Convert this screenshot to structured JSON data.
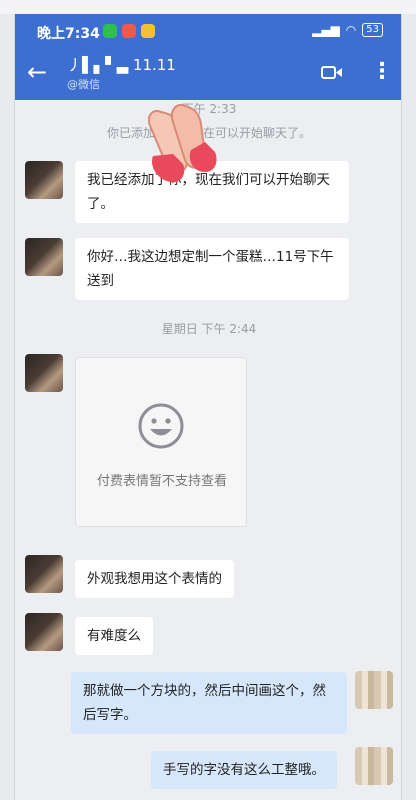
{
  "status_bar": {
    "time": "晚上7:34",
    "battery": "53"
  },
  "header": {
    "title": "丿▌▖▘▃ 11.11",
    "subtitle": "@微信",
    "back_icon": "back-arrow-icon",
    "video_icon": "video-call-icon",
    "more_icon": "more-vertical-icon"
  },
  "messages": {
    "ts1": "下午 2:33",
    "system": "你已添加了…，现在可以开始聊天了。",
    "m1": "我已经添加了你，现在我们可以开始聊天了。",
    "m2": "你好…我这边想定制一个蛋糕…11号下午送到",
    "ts2": "星期日 下午 2:44",
    "sticker_caption": "付费表情暂不支持查看",
    "m3": "外观我想用这个表情的",
    "m4": "有难度么",
    "m5": "那就做一个方块的，然后中间画这个，然后写字。",
    "m6": "手写的字没有这么工整哦。"
  },
  "colors": {
    "header": "#3d6fd0",
    "my_bubble": "#d6e6fb",
    "their_bubble": "#ffffff"
  }
}
